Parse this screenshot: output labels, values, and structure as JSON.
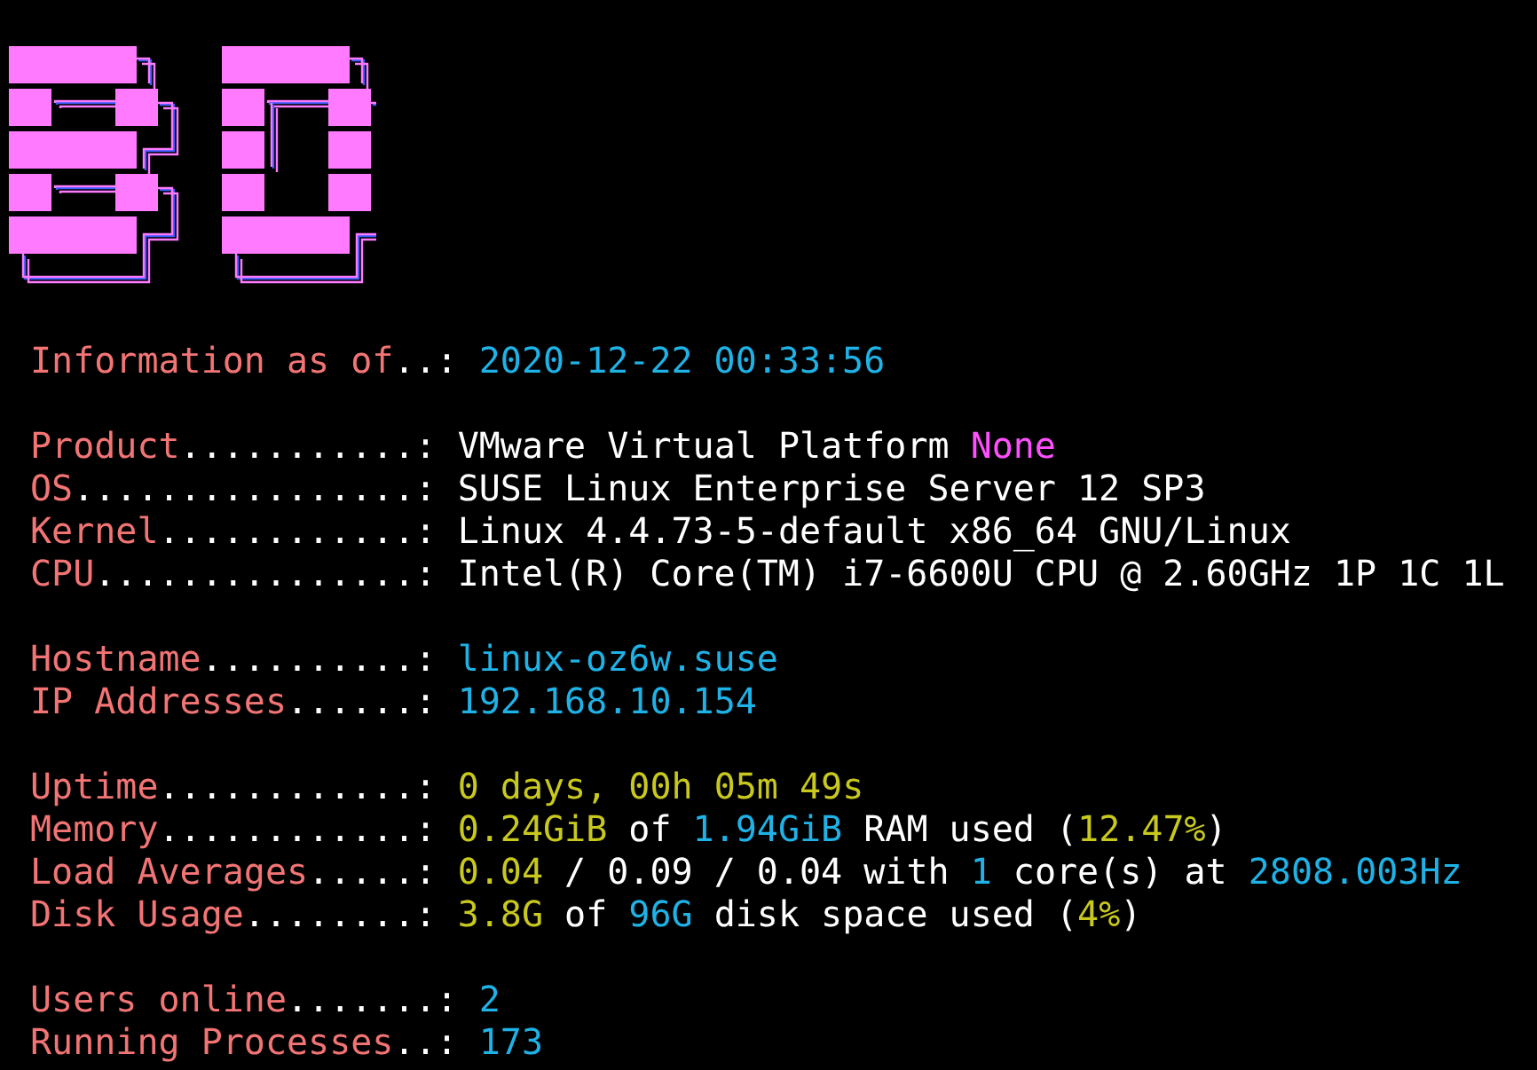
{
  "sections": [
    {
      "rows": [
        {
          "label": "Information as of",
          "leader": "..:",
          "value": [
            {
              "text": "2020-12-22 00:33:56",
              "color": "#1fb2e6"
            }
          ]
        }
      ]
    },
    {
      "rows": [
        {
          "label": "Product",
          "leader": "...........:",
          "value": [
            {
              "text": "VMware Virtual Platform ",
              "color": "#ffffff"
            },
            {
              "text": "None",
              "color": "#ff4fff"
            }
          ]
        },
        {
          "label": "OS",
          "leader": "................:",
          "value": [
            {
              "text": "SUSE Linux Enterprise Server 12 SP3",
              "color": "#ffffff"
            }
          ]
        },
        {
          "label": "Kernel",
          "leader": "............:",
          "value": [
            {
              "text": "Linux 4.4.73-5-default x86_64 GNU/Linux",
              "color": "#ffffff"
            }
          ]
        },
        {
          "label": "CPU",
          "leader": "...............:",
          "value": [
            {
              "text": "Intel(R) Core(TM) i7-6600U CPU @ 2.60GHz 1P 1C 1L",
              "color": "#ffffff"
            }
          ]
        }
      ]
    },
    {
      "rows": [
        {
          "label": "Hostname",
          "leader": "..........:",
          "value": [
            {
              "text": "linux-oz6w.suse",
              "color": "#1fb2e6"
            }
          ]
        },
        {
          "label": "IP Addresses",
          "leader": "......:",
          "value": [
            {
              "text": "192.168.10.154",
              "color": "#1fb2e6"
            }
          ]
        }
      ]
    },
    {
      "rows": [
        {
          "label": "Uptime",
          "leader": "............:",
          "value": [
            {
              "text": "0 days, 00h 05m 49s",
              "color": "#c8c81e"
            }
          ]
        },
        {
          "label": "Memory",
          "leader": "............:",
          "value": [
            {
              "text": "0.24GiB",
              "color": "#c8c81e"
            },
            {
              "text": " of ",
              "color": "#ffffff"
            },
            {
              "text": "1.94GiB",
              "color": "#1fb2e6"
            },
            {
              "text": " RAM used (",
              "color": "#ffffff"
            },
            {
              "text": "12.47%",
              "color": "#c8c81e"
            },
            {
              "text": ")",
              "color": "#ffffff"
            }
          ]
        },
        {
          "label": "Load Averages",
          "leader": ".....:",
          "value": [
            {
              "text": "0.04",
              "color": "#c8c81e"
            },
            {
              "text": " / 0.09 / 0.04 with ",
              "color": "#ffffff"
            },
            {
              "text": "1",
              "color": "#1fb2e6"
            },
            {
              "text": " core(s) at ",
              "color": "#ffffff"
            },
            {
              "text": "2808.003Hz",
              "color": "#1fb2e6"
            }
          ]
        },
        {
          "label": "Disk Usage",
          "leader": "........:",
          "value": [
            {
              "text": "3.8G",
              "color": "#c8c81e"
            },
            {
              "text": " of ",
              "color": "#ffffff"
            },
            {
              "text": "96G",
              "color": "#1fb2e6"
            },
            {
              "text": " disk space used (",
              "color": "#ffffff"
            },
            {
              "text": "4%",
              "color": "#c8c81e"
            },
            {
              "text": ")",
              "color": "#ffffff"
            }
          ]
        }
      ]
    },
    {
      "rows": [
        {
          "label": "Users online",
          "leader": ".......:",
          "value": [
            {
              "text": "2",
              "color": "#1fb2e6"
            }
          ]
        },
        {
          "label": "Running Processes",
          "leader": "..:",
          "value": [
            {
              "text": "173",
              "color": "#1fb2e6"
            }
          ]
        }
      ]
    }
  ]
}
